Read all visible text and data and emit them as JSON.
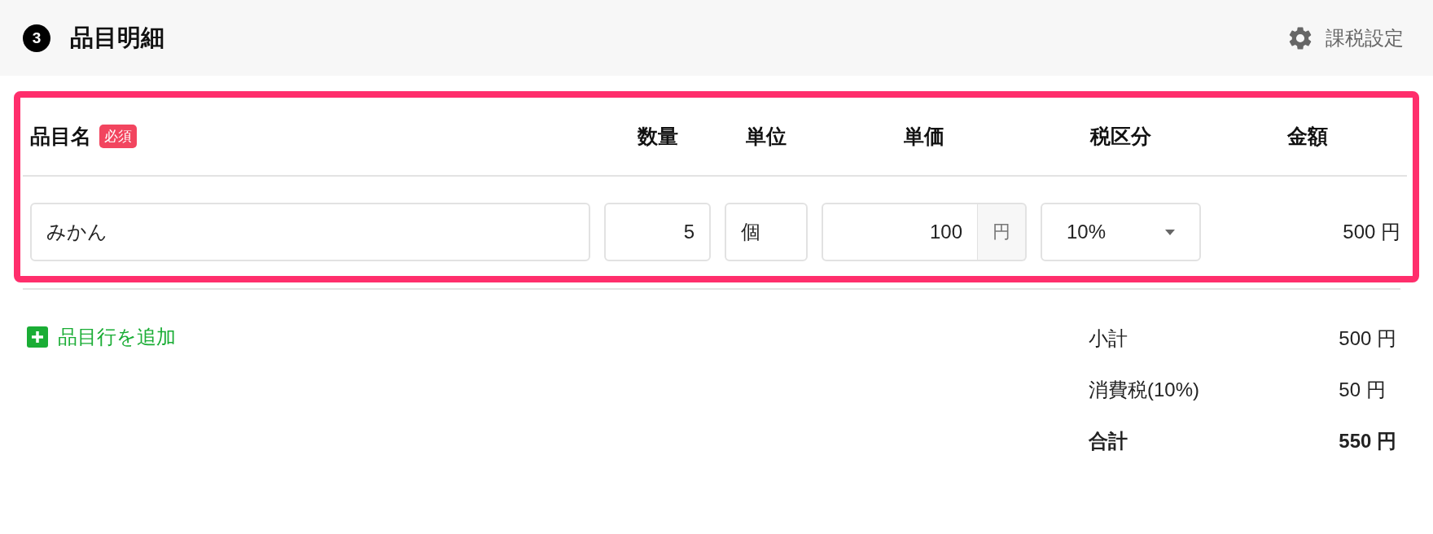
{
  "section": {
    "step": "3",
    "title": "品目明細",
    "settings_label": "課税設定"
  },
  "table": {
    "columns": [
      {
        "label": "品目名",
        "badge": "必須"
      },
      {
        "label": "数量"
      },
      {
        "label": "単位"
      },
      {
        "label": "単価"
      },
      {
        "label": "税区分"
      },
      {
        "label": "金額"
      }
    ],
    "row": {
      "name": "みかん",
      "quantity": "5",
      "unit": "個",
      "unit_price": "100",
      "currency": "円",
      "tax_rate": "10%",
      "amount": "500 円"
    }
  },
  "add_row": "品目行を追加",
  "totals": [
    {
      "label": "小計",
      "value": "500 円",
      "emphasized": false
    },
    {
      "label": "消費税(10%)",
      "value": "50 円",
      "emphasized": false
    },
    {
      "label": "合計",
      "value": "550 円",
      "emphasized": true
    }
  ]
}
